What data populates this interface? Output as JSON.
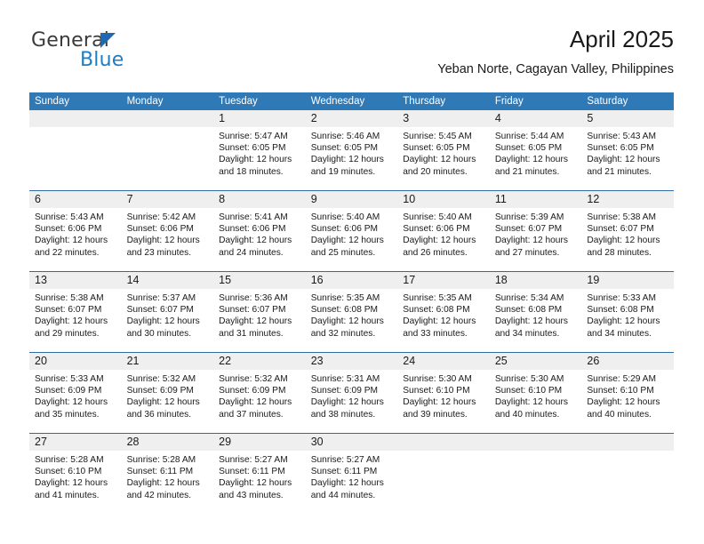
{
  "brand": {
    "name_top": "General",
    "name_bottom": "Blue",
    "triangle_color": "#1f69b0",
    "blue_text_color": "#1f7dc4"
  },
  "header": {
    "title": "April 2025",
    "subtitle": "Yeban Norte, Cagayan Valley, Philippines"
  },
  "colors": {
    "header_blue": "#3079b7",
    "week_divider_blue": "#2e6da4",
    "daynum_band_gray": "#efefef"
  },
  "weekday_headers": [
    "Sunday",
    "Monday",
    "Tuesday",
    "Wednesday",
    "Thursday",
    "Friday",
    "Saturday"
  ],
  "weeks": [
    [
      {
        "day": "",
        "lines": []
      },
      {
        "day": "",
        "lines": []
      },
      {
        "day": "1",
        "lines": [
          "Sunrise: 5:47 AM",
          "Sunset: 6:05 PM",
          "Daylight: 12 hours",
          "and 18 minutes."
        ]
      },
      {
        "day": "2",
        "lines": [
          "Sunrise: 5:46 AM",
          "Sunset: 6:05 PM",
          "Daylight: 12 hours",
          "and 19 minutes."
        ]
      },
      {
        "day": "3",
        "lines": [
          "Sunrise: 5:45 AM",
          "Sunset: 6:05 PM",
          "Daylight: 12 hours",
          "and 20 minutes."
        ]
      },
      {
        "day": "4",
        "lines": [
          "Sunrise: 5:44 AM",
          "Sunset: 6:05 PM",
          "Daylight: 12 hours",
          "and 21 minutes."
        ]
      },
      {
        "day": "5",
        "lines": [
          "Sunrise: 5:43 AM",
          "Sunset: 6:05 PM",
          "Daylight: 12 hours",
          "and 21 minutes."
        ]
      }
    ],
    [
      {
        "day": "6",
        "lines": [
          "Sunrise: 5:43 AM",
          "Sunset: 6:06 PM",
          "Daylight: 12 hours",
          "and 22 minutes."
        ]
      },
      {
        "day": "7",
        "lines": [
          "Sunrise: 5:42 AM",
          "Sunset: 6:06 PM",
          "Daylight: 12 hours",
          "and 23 minutes."
        ]
      },
      {
        "day": "8",
        "lines": [
          "Sunrise: 5:41 AM",
          "Sunset: 6:06 PM",
          "Daylight: 12 hours",
          "and 24 minutes."
        ]
      },
      {
        "day": "9",
        "lines": [
          "Sunrise: 5:40 AM",
          "Sunset: 6:06 PM",
          "Daylight: 12 hours",
          "and 25 minutes."
        ]
      },
      {
        "day": "10",
        "lines": [
          "Sunrise: 5:40 AM",
          "Sunset: 6:06 PM",
          "Daylight: 12 hours",
          "and 26 minutes."
        ]
      },
      {
        "day": "11",
        "lines": [
          "Sunrise: 5:39 AM",
          "Sunset: 6:07 PM",
          "Daylight: 12 hours",
          "and 27 minutes."
        ]
      },
      {
        "day": "12",
        "lines": [
          "Sunrise: 5:38 AM",
          "Sunset: 6:07 PM",
          "Daylight: 12 hours",
          "and 28 minutes."
        ]
      }
    ],
    [
      {
        "day": "13",
        "lines": [
          "Sunrise: 5:38 AM",
          "Sunset: 6:07 PM",
          "Daylight: 12 hours",
          "and 29 minutes."
        ]
      },
      {
        "day": "14",
        "lines": [
          "Sunrise: 5:37 AM",
          "Sunset: 6:07 PM",
          "Daylight: 12 hours",
          "and 30 minutes."
        ]
      },
      {
        "day": "15",
        "lines": [
          "Sunrise: 5:36 AM",
          "Sunset: 6:07 PM",
          "Daylight: 12 hours",
          "and 31 minutes."
        ]
      },
      {
        "day": "16",
        "lines": [
          "Sunrise: 5:35 AM",
          "Sunset: 6:08 PM",
          "Daylight: 12 hours",
          "and 32 minutes."
        ]
      },
      {
        "day": "17",
        "lines": [
          "Sunrise: 5:35 AM",
          "Sunset: 6:08 PM",
          "Daylight: 12 hours",
          "and 33 minutes."
        ]
      },
      {
        "day": "18",
        "lines": [
          "Sunrise: 5:34 AM",
          "Sunset: 6:08 PM",
          "Daylight: 12 hours",
          "and 34 minutes."
        ]
      },
      {
        "day": "19",
        "lines": [
          "Sunrise: 5:33 AM",
          "Sunset: 6:08 PM",
          "Daylight: 12 hours",
          "and 34 minutes."
        ]
      }
    ],
    [
      {
        "day": "20",
        "lines": [
          "Sunrise: 5:33 AM",
          "Sunset: 6:09 PM",
          "Daylight: 12 hours",
          "and 35 minutes."
        ]
      },
      {
        "day": "21",
        "lines": [
          "Sunrise: 5:32 AM",
          "Sunset: 6:09 PM",
          "Daylight: 12 hours",
          "and 36 minutes."
        ]
      },
      {
        "day": "22",
        "lines": [
          "Sunrise: 5:32 AM",
          "Sunset: 6:09 PM",
          "Daylight: 12 hours",
          "and 37 minutes."
        ]
      },
      {
        "day": "23",
        "lines": [
          "Sunrise: 5:31 AM",
          "Sunset: 6:09 PM",
          "Daylight: 12 hours",
          "and 38 minutes."
        ]
      },
      {
        "day": "24",
        "lines": [
          "Sunrise: 5:30 AM",
          "Sunset: 6:10 PM",
          "Daylight: 12 hours",
          "and 39 minutes."
        ]
      },
      {
        "day": "25",
        "lines": [
          "Sunrise: 5:30 AM",
          "Sunset: 6:10 PM",
          "Daylight: 12 hours",
          "and 40 minutes."
        ]
      },
      {
        "day": "26",
        "lines": [
          "Sunrise: 5:29 AM",
          "Sunset: 6:10 PM",
          "Daylight: 12 hours",
          "and 40 minutes."
        ]
      }
    ],
    [
      {
        "day": "27",
        "lines": [
          "Sunrise: 5:28 AM",
          "Sunset: 6:10 PM",
          "Daylight: 12 hours",
          "and 41 minutes."
        ]
      },
      {
        "day": "28",
        "lines": [
          "Sunrise: 5:28 AM",
          "Sunset: 6:11 PM",
          "Daylight: 12 hours",
          "and 42 minutes."
        ]
      },
      {
        "day": "29",
        "lines": [
          "Sunrise: 5:27 AM",
          "Sunset: 6:11 PM",
          "Daylight: 12 hours",
          "and 43 minutes."
        ]
      },
      {
        "day": "30",
        "lines": [
          "Sunrise: 5:27 AM",
          "Sunset: 6:11 PM",
          "Daylight: 12 hours",
          "and 44 minutes."
        ]
      },
      {
        "day": "",
        "lines": []
      },
      {
        "day": "",
        "lines": []
      },
      {
        "day": "",
        "lines": []
      }
    ]
  ]
}
